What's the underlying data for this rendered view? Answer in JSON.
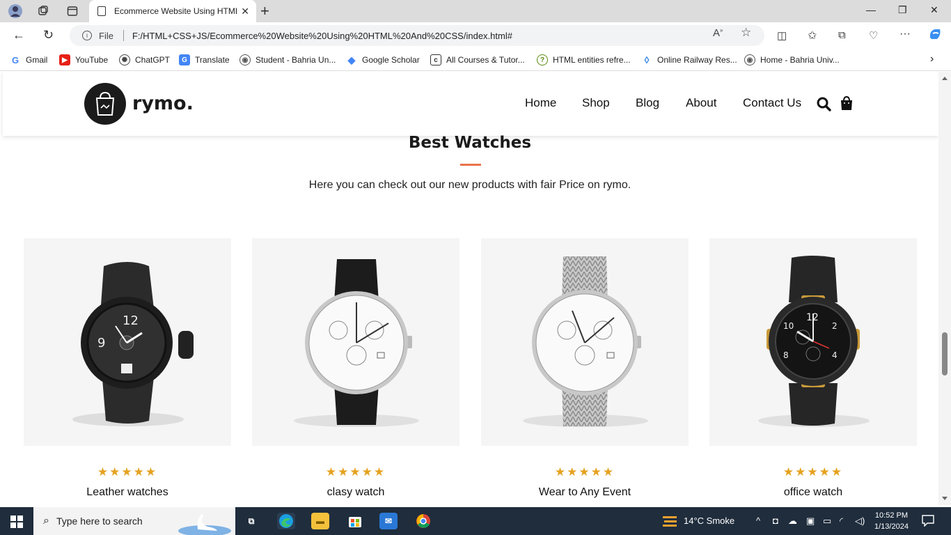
{
  "browser": {
    "tab_title": "Ecommerce Website Using HTML",
    "address_scheme": "File",
    "address_url": "F:/HTML+CSS+JS/Ecommerce%20Website%20Using%20HTML%20And%20CSS/index.html#",
    "bookmarks": [
      "Gmail",
      "YouTube",
      "ChatGPT",
      "Translate",
      "Student - Bahria Un...",
      "Google Scholar",
      "All Courses & Tutor...",
      "HTML entities refre...",
      "Online Railway Res...",
      "Home - Bahria Univ..."
    ]
  },
  "site": {
    "logo_text": "rymo.",
    "nav": [
      "Home",
      "Shop",
      "Blog",
      "About",
      "Contact Us"
    ]
  },
  "section": {
    "title": "Best Watches",
    "subtitle": "Here you can check out our new products with fair Price on rymo."
  },
  "products": [
    {
      "name": "Leather watches",
      "stars": "★★★★★",
      "rating": 5
    },
    {
      "name": "clasy watch",
      "stars": "★★★★★",
      "rating": 5
    },
    {
      "name": "Wear to Any Event",
      "stars": "★★★★★",
      "rating": 5
    },
    {
      "name": "office watch",
      "stars": "★★★★★",
      "rating": 5
    }
  ],
  "taskbar": {
    "search_placeholder": "Type here to search",
    "weather": "14°C  Smoke",
    "time": "10:52 PM",
    "date": "1/13/2024"
  },
  "colors": {
    "accent_rule": "#e8734a",
    "star": "#e6a220",
    "logo": "#1b1b1b"
  }
}
